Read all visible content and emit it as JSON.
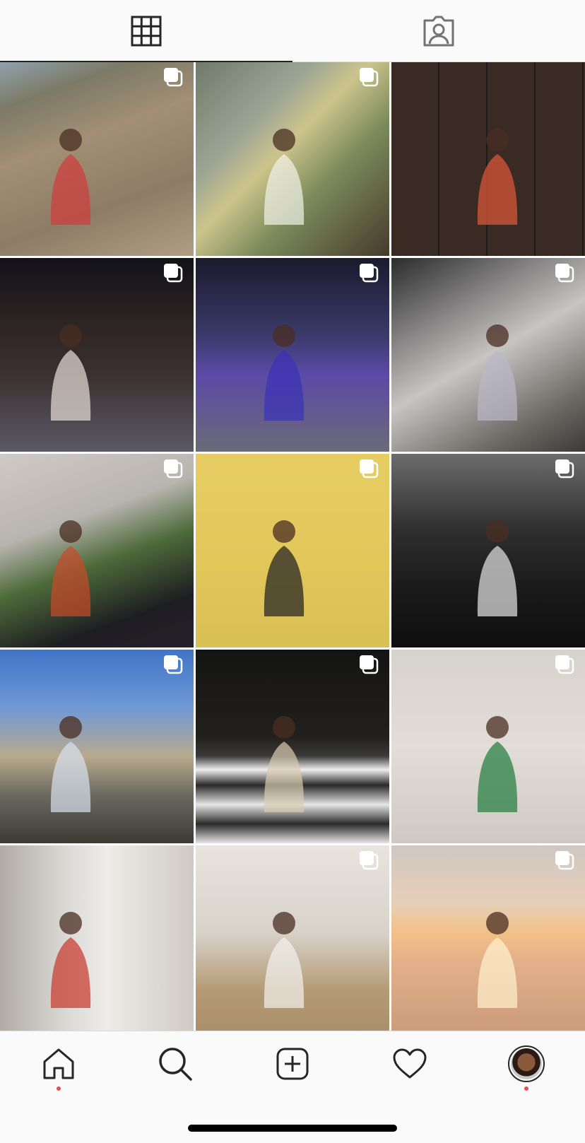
{
  "top_tabs": [
    {
      "icon": "grid-icon",
      "active": true
    },
    {
      "icon": "tagged-person-icon",
      "active": false
    }
  ],
  "posts": [
    {
      "desc": "cliff",
      "multi": true,
      "bg": "linear-gradient(160deg,#8fa1ad 0%,#7c7a66 18%,#a28f75 40%,#8d7c66 70%,#b19d84 100%)",
      "accent": "#d13a3a"
    },
    {
      "desc": "mirror-portrait",
      "multi": true,
      "bg": "linear-gradient(135deg,#6f7a6a 0%,#9aa595 30%,#ccc48c 45%,#7a8a5a 65%,#473a2c 100%)",
      "accent": "#f2f2ea"
    },
    {
      "desc": "video-call",
      "multi": false,
      "bg": "repeating-linear-gradient(90deg,#3a2a24 0 66px,#1b1b1b 66px 68px), repeating-linear-gradient(0deg,#5a3c30 0 46px,#1b1b1b 46px 48px)",
      "accent": "#e25a3a"
    },
    {
      "desc": "night-masks",
      "multi": true,
      "bg": "linear-gradient(180deg,#121218 0%,#2b2222 30%,#3c3030 60%,#5a5a66 100%)",
      "accent": "#e8e0d8"
    },
    {
      "desc": "purple-suit-street",
      "multi": true,
      "bg": "linear-gradient(180deg,#1a1a2c 0%,#3b3a6a 40%,#5b4aa6 60%,#6a6a78 100%)",
      "accent": "#3a32b8"
    },
    {
      "desc": "stairwell",
      "multi": true,
      "bg": "linear-gradient(150deg,#2c2c2c 0%,#8a8888 30%,#c7c4c2 50%,#6e6a66 80%,#3c3a38 100%)",
      "accent": "#b9b9c9"
    },
    {
      "desc": "plant-portrait",
      "multi": true,
      "bg": "linear-gradient(160deg,#cfcac6 0%,#b8b4b0 35%,#4e6a3a 55%,#1e1e22 80%,#262028 100%)",
      "accent": "#c94a2a"
    },
    {
      "desc": "yellow-suits",
      "multi": true,
      "bg": "linear-gradient(180deg,#e6cd63 0%,#e2c75b 55%,#d8bf56 100%)",
      "accent": "#1d1d20"
    },
    {
      "desc": "bw-group",
      "multi": true,
      "bg": "linear-gradient(180deg,#6c6c6c 0%,#2e2e2e 40%,#1a1a1a 70%,#0e0e0e 100%)",
      "accent": "#e6e6e6"
    },
    {
      "desc": "park-arch",
      "multi": true,
      "bg": "linear-gradient(180deg,#3f74c8 0%,#6f99d6 30%,#b9aa8e 55%,#6b6960 75%,#3d3a36 100%)",
      "accent": "#d9e1ee"
    },
    {
      "desc": "crosswalk-night",
      "multi": true,
      "bg": "linear-gradient(180deg,#141414 0%,#22201c 45%,#3a3a3a 55%,#eeeeee 62%,#2a2a2a 70%,#e6e6e6 80%,#2a2a2a 90%,#e6e6e6 100%)",
      "accent": "#d9ccb0"
    },
    {
      "desc": "green-jacket-duo",
      "multi": true,
      "bg": "linear-gradient(180deg,#d6d2cc 0%,#e2ddd7 50%,#cfc9c2 100%)",
      "accent": "#1e7a3a"
    },
    {
      "desc": "white-shirt-portrait",
      "multi": false,
      "bg": "linear-gradient(90deg,#b0aca5 0%,#dcdad6 35%,#eeece8 55%,#cfcac4 100%)",
      "accent": "#c8342a"
    },
    {
      "desc": "seated-duo",
      "multi": true,
      "bg": "linear-gradient(180deg,#e8e4de 0%,#d8d2ca 45%,#b49a74 75%,#a88d6a 100%)",
      "accent": "#f2f2f0"
    },
    {
      "desc": "desert-sunset",
      "multi": true,
      "bg": "linear-gradient(180deg,#cfc7c3 0%,#e6cfb8 30%,#f2c188 45%,#e3b08a 60%,#c9997a 100%)",
      "accent": "#fff2cf"
    }
  ],
  "bottom_nav": [
    {
      "icon": "home-icon",
      "badge": true
    },
    {
      "icon": "search-icon",
      "badge": false
    },
    {
      "icon": "new-post-icon",
      "badge": false
    },
    {
      "icon": "heart-icon",
      "badge": false
    },
    {
      "icon": "profile-avatar",
      "badge": true
    }
  ],
  "colors": {
    "icon": "#262626",
    "badge": "#ed4956",
    "divider": "#dbdbdb",
    "background": "#fafafa"
  }
}
